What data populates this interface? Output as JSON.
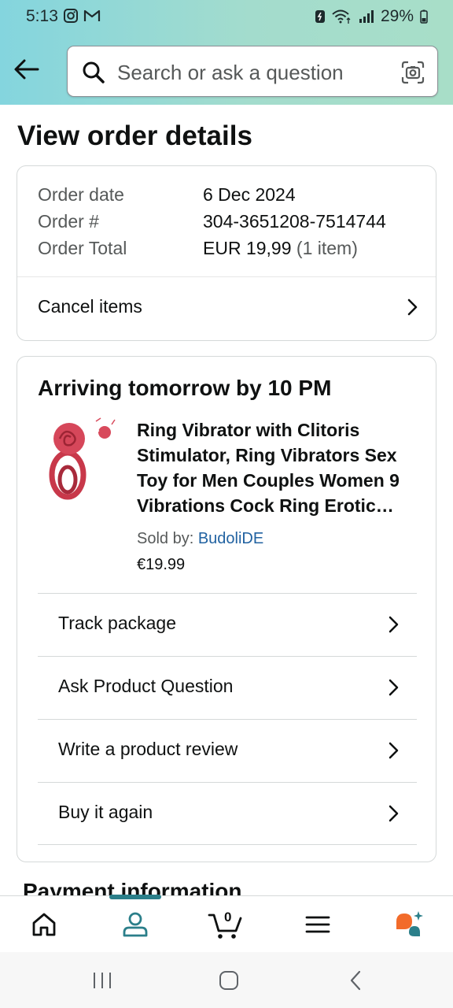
{
  "status_bar": {
    "time": "5:13",
    "battery": "29%"
  },
  "search": {
    "placeholder": "Search or ask a question"
  },
  "page_title": "View order details",
  "order": {
    "date_label": "Order date",
    "date_value": "6 Dec 2024",
    "number_label": "Order #",
    "number_value": "304-3651208-7514744",
    "total_label": "Order Total",
    "total_value": "EUR 19,99",
    "total_items": "(1 item)",
    "cancel_label": "Cancel items"
  },
  "shipment": {
    "arriving": "Arriving tomorrow by 10 PM",
    "product_title": "Ring Vibrator with Clitoris Stimulator, Ring Vibrators Sex Toy for Men Couples Women 9 Vibrations Cock Ring Erotic…",
    "sold_by_label": "Sold by:",
    "seller": "BudoliDE",
    "price": "€19.99",
    "actions": [
      {
        "label": "Track package"
      },
      {
        "label": "Ask Product Question"
      },
      {
        "label": "Write a product review"
      },
      {
        "label": "Buy it again"
      }
    ]
  },
  "payment_heading": "Payment information",
  "bottom_nav": {
    "cart_count": "0"
  },
  "colors": {
    "header_start": "#84d5de",
    "header_end": "#a8dec8",
    "link": "#2162a1",
    "nav_accent": "#2b7f8a"
  },
  "icons": [
    "back-arrow-icon",
    "search-icon",
    "camera-icon",
    "chevron-right-icon",
    "home-icon",
    "account-icon",
    "cart-icon",
    "menu-icon",
    "rufus-ai-icon"
  ]
}
